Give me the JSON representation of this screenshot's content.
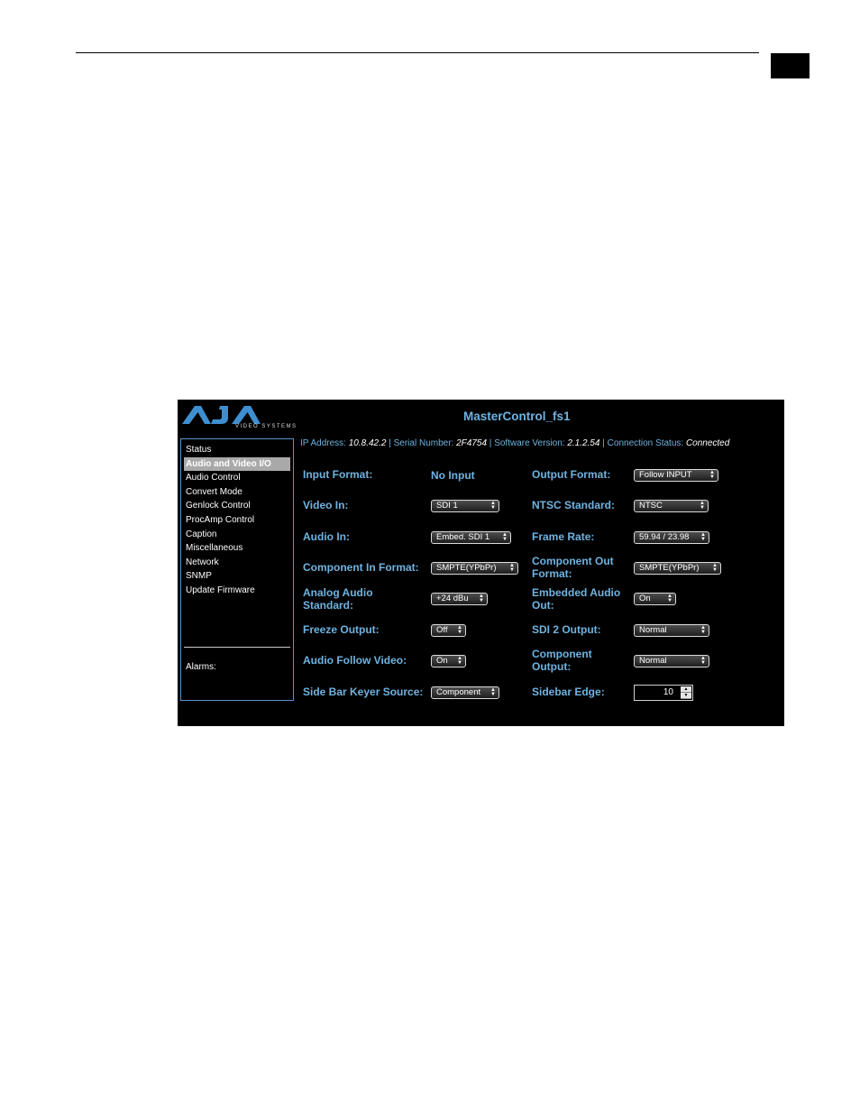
{
  "app": {
    "title": "MasterControl_fs1",
    "logo_text": "AJA",
    "logo_sub": "VIDEO SYSTEMS"
  },
  "info": {
    "ip_label": "IP Address:",
    "ip": "10.8.42.2",
    "serial_label": "Serial Number:",
    "serial": "2F4754",
    "sw_label": "Software Version:",
    "sw": "2.1.2.54",
    "conn_label": "Connection Status:",
    "conn": "Connected"
  },
  "sidebar": {
    "items": [
      {
        "label": "Status"
      },
      {
        "label": "Audio and Video I/O"
      },
      {
        "label": "Audio Control"
      },
      {
        "label": "Convert Mode"
      },
      {
        "label": "Genlock Control"
      },
      {
        "label": "ProcAmp Control"
      },
      {
        "label": "Caption"
      },
      {
        "label": "Miscellaneous"
      },
      {
        "label": "Network"
      },
      {
        "label": "SNMP"
      },
      {
        "label": "Update Firmware"
      }
    ],
    "active_index": 1,
    "alarms_label": "Alarms:"
  },
  "form": {
    "input_format": {
      "label": "Input Format:",
      "value": "No Input"
    },
    "video_in": {
      "label": "Video In:",
      "value": "SDI 1"
    },
    "audio_in": {
      "label": "Audio In:",
      "value": "Embed. SDI 1"
    },
    "component_in_format": {
      "label": "Component In Format:",
      "value": "SMPTE(YPbPr)"
    },
    "analog_audio_standard": {
      "label_1": "Analog Audio",
      "label_2": "Standard:",
      "value": "+24 dBu"
    },
    "freeze_output": {
      "label": "Freeze Output:",
      "value": "Off"
    },
    "audio_follow_video": {
      "label": "Audio Follow Video:",
      "value": "On"
    },
    "side_bar_keyer_source": {
      "label": "Side Bar Keyer Source:",
      "value": "Component"
    },
    "output_format": {
      "label": "Output Format:",
      "value": "Follow INPUT"
    },
    "ntsc_standard": {
      "label": "NTSC Standard:",
      "value": "NTSC"
    },
    "frame_rate": {
      "label": "Frame Rate:",
      "value": "59.94 / 23.98"
    },
    "component_out_format": {
      "label_1": "Component Out",
      "label_2": "Format:",
      "value": "SMPTE(YPbPr)"
    },
    "embedded_audio_out": {
      "label_1": "Embedded Audio",
      "label_2": "Out:",
      "value": "On"
    },
    "sdi2_output": {
      "label": "SDI 2 Output:",
      "value": "Normal"
    },
    "component_output": {
      "label_1": "Component",
      "label_2": "Output:",
      "value": "Normal"
    },
    "sidebar_edge": {
      "label": "Sidebar Edge:",
      "value": "10"
    }
  }
}
